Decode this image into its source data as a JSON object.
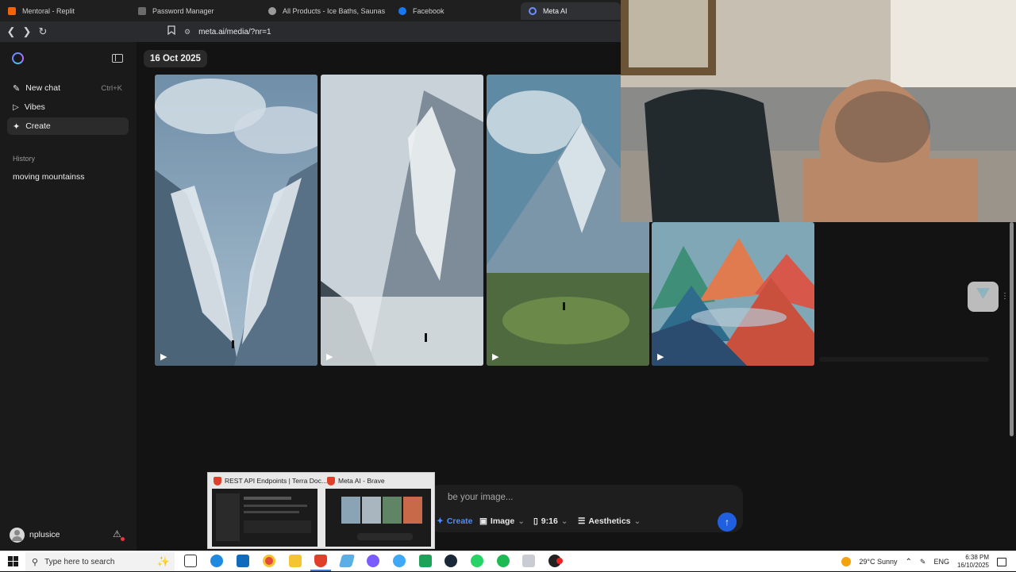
{
  "browser": {
    "tabs": [
      {
        "label": "Mentoral - Replit",
        "icon": "replit-icon",
        "color": "#f26207"
      },
      {
        "label": "Password Manager",
        "icon": "key-icon",
        "color": "#6b6b6b"
      },
      {
        "label": "All Products - Ice Baths, Saunas & Re",
        "icon": "globe-icon",
        "color": "#9a9a9a"
      },
      {
        "label": "Facebook",
        "icon": "facebook-icon",
        "color": "#1877f2"
      },
      {
        "label": "Meta AI",
        "icon": "meta-ai-icon",
        "color": "#6e8cff"
      }
    ],
    "url": "meta.ai/media/?nr=1"
  },
  "sidebar": {
    "items": [
      {
        "label": "New chat",
        "shortcut": "Ctrl+K",
        "icon": "edit-icon"
      },
      {
        "label": "Vibes",
        "icon": "play-square-icon"
      },
      {
        "label": "Create",
        "icon": "sparkle-icon"
      }
    ],
    "history_heading": "History",
    "history_items": [
      "moving mountainss"
    ],
    "user": "nplusice"
  },
  "main": {
    "date": "16 Oct 2025",
    "media": [
      {
        "name": "mountain-video-1",
        "type": "video"
      },
      {
        "name": "mountain-video-2",
        "type": "video"
      },
      {
        "name": "mountain-video-3",
        "type": "video"
      },
      {
        "name": "mountain-video-4",
        "type": "video"
      }
    ]
  },
  "prompt": {
    "placeholder": "be your image...",
    "create_label": "Create",
    "image_label": "Image",
    "ratio_label": "9:16",
    "aesthetics_label": "Aesthetics"
  },
  "thumbnails": [
    {
      "title": "REST API Endpoints | Terra Doc...",
      "icon": "brave-icon"
    },
    {
      "title": "Meta AI - Brave",
      "icon": "brave-icon"
    }
  ],
  "taskbar": {
    "search_placeholder": "Type here to search",
    "weather": "29°C  Sunny",
    "language": "ENG",
    "time": "6:38 PM",
    "date": "16/10/2025"
  },
  "colors": {
    "accent": "#2060e0",
    "sidebar_bg": "#1a1a1a",
    "main_bg": "#131313"
  }
}
